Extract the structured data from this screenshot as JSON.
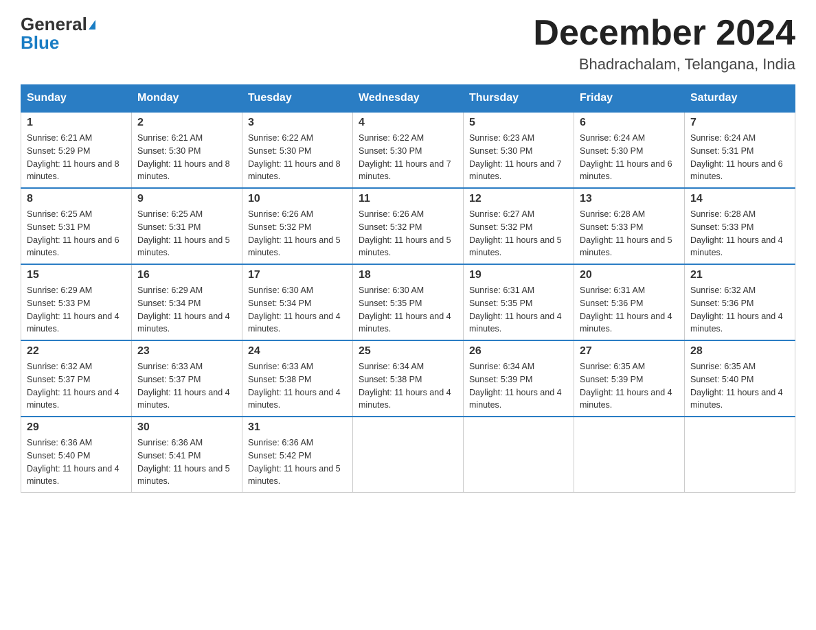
{
  "logo": {
    "text_general": "General",
    "text_blue": "Blue"
  },
  "title": "December 2024",
  "location": "Bhadrachalam, Telangana, India",
  "days_of_week": [
    "Sunday",
    "Monday",
    "Tuesday",
    "Wednesday",
    "Thursday",
    "Friday",
    "Saturday"
  ],
  "weeks": [
    [
      {
        "day": "1",
        "sunrise": "6:21 AM",
        "sunset": "5:29 PM",
        "daylight": "11 hours and 8 minutes."
      },
      {
        "day": "2",
        "sunrise": "6:21 AM",
        "sunset": "5:30 PM",
        "daylight": "11 hours and 8 minutes."
      },
      {
        "day": "3",
        "sunrise": "6:22 AM",
        "sunset": "5:30 PM",
        "daylight": "11 hours and 8 minutes."
      },
      {
        "day": "4",
        "sunrise": "6:22 AM",
        "sunset": "5:30 PM",
        "daylight": "11 hours and 7 minutes."
      },
      {
        "day": "5",
        "sunrise": "6:23 AM",
        "sunset": "5:30 PM",
        "daylight": "11 hours and 7 minutes."
      },
      {
        "day": "6",
        "sunrise": "6:24 AM",
        "sunset": "5:30 PM",
        "daylight": "11 hours and 6 minutes."
      },
      {
        "day": "7",
        "sunrise": "6:24 AM",
        "sunset": "5:31 PM",
        "daylight": "11 hours and 6 minutes."
      }
    ],
    [
      {
        "day": "8",
        "sunrise": "6:25 AM",
        "sunset": "5:31 PM",
        "daylight": "11 hours and 6 minutes."
      },
      {
        "day": "9",
        "sunrise": "6:25 AM",
        "sunset": "5:31 PM",
        "daylight": "11 hours and 5 minutes."
      },
      {
        "day": "10",
        "sunrise": "6:26 AM",
        "sunset": "5:32 PM",
        "daylight": "11 hours and 5 minutes."
      },
      {
        "day": "11",
        "sunrise": "6:26 AM",
        "sunset": "5:32 PM",
        "daylight": "11 hours and 5 minutes."
      },
      {
        "day": "12",
        "sunrise": "6:27 AM",
        "sunset": "5:32 PM",
        "daylight": "11 hours and 5 minutes."
      },
      {
        "day": "13",
        "sunrise": "6:28 AM",
        "sunset": "5:33 PM",
        "daylight": "11 hours and 5 minutes."
      },
      {
        "day": "14",
        "sunrise": "6:28 AM",
        "sunset": "5:33 PM",
        "daylight": "11 hours and 4 minutes."
      }
    ],
    [
      {
        "day": "15",
        "sunrise": "6:29 AM",
        "sunset": "5:33 PM",
        "daylight": "11 hours and 4 minutes."
      },
      {
        "day": "16",
        "sunrise": "6:29 AM",
        "sunset": "5:34 PM",
        "daylight": "11 hours and 4 minutes."
      },
      {
        "day": "17",
        "sunrise": "6:30 AM",
        "sunset": "5:34 PM",
        "daylight": "11 hours and 4 minutes."
      },
      {
        "day": "18",
        "sunrise": "6:30 AM",
        "sunset": "5:35 PM",
        "daylight": "11 hours and 4 minutes."
      },
      {
        "day": "19",
        "sunrise": "6:31 AM",
        "sunset": "5:35 PM",
        "daylight": "11 hours and 4 minutes."
      },
      {
        "day": "20",
        "sunrise": "6:31 AM",
        "sunset": "5:36 PM",
        "daylight": "11 hours and 4 minutes."
      },
      {
        "day": "21",
        "sunrise": "6:32 AM",
        "sunset": "5:36 PM",
        "daylight": "11 hours and 4 minutes."
      }
    ],
    [
      {
        "day": "22",
        "sunrise": "6:32 AM",
        "sunset": "5:37 PM",
        "daylight": "11 hours and 4 minutes."
      },
      {
        "day": "23",
        "sunrise": "6:33 AM",
        "sunset": "5:37 PM",
        "daylight": "11 hours and 4 minutes."
      },
      {
        "day": "24",
        "sunrise": "6:33 AM",
        "sunset": "5:38 PM",
        "daylight": "11 hours and 4 minutes."
      },
      {
        "day": "25",
        "sunrise": "6:34 AM",
        "sunset": "5:38 PM",
        "daylight": "11 hours and 4 minutes."
      },
      {
        "day": "26",
        "sunrise": "6:34 AM",
        "sunset": "5:39 PM",
        "daylight": "11 hours and 4 minutes."
      },
      {
        "day": "27",
        "sunrise": "6:35 AM",
        "sunset": "5:39 PM",
        "daylight": "11 hours and 4 minutes."
      },
      {
        "day": "28",
        "sunrise": "6:35 AM",
        "sunset": "5:40 PM",
        "daylight": "11 hours and 4 minutes."
      }
    ],
    [
      {
        "day": "29",
        "sunrise": "6:36 AM",
        "sunset": "5:40 PM",
        "daylight": "11 hours and 4 minutes."
      },
      {
        "day": "30",
        "sunrise": "6:36 AM",
        "sunset": "5:41 PM",
        "daylight": "11 hours and 5 minutes."
      },
      {
        "day": "31",
        "sunrise": "6:36 AM",
        "sunset": "5:42 PM",
        "daylight": "11 hours and 5 minutes."
      },
      null,
      null,
      null,
      null
    ]
  ]
}
